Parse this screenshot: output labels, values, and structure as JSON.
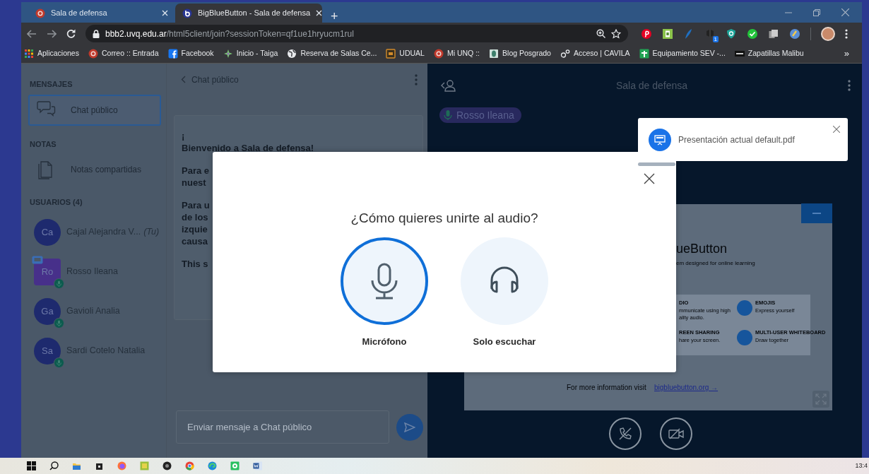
{
  "browser": {
    "tabs": [
      {
        "title": "Sala de defensa",
        "selected": false,
        "kind": "seal"
      },
      {
        "title": "BigBlueButton - Sala de defensa",
        "selected": true,
        "kind": "bbb"
      }
    ],
    "new_tab": "+",
    "address": {
      "host": "bbb2.uvq.edu.ar",
      "path": "/html5client/join?sessionToken=qf1ue1hryucm1rul"
    },
    "extension_badge": "1",
    "bookmarks": [
      {
        "label": "Aplicaciones",
        "kind": "apps"
      },
      {
        "label": "Correo :: Entrada",
        "kind": "seal"
      },
      {
        "label": "Facebook",
        "kind": "facebook"
      },
      {
        "label": "Inicio - Taiga",
        "kind": "taiga"
      },
      {
        "label": "Reserva de Salas Ce...",
        "kind": "globe"
      },
      {
        "label": "UDUAL",
        "kind": "box"
      },
      {
        "label": "Mi UNQ ::",
        "kind": "seal"
      },
      {
        "label": "Blog Posgrado",
        "kind": "doc"
      },
      {
        "label": "Acceso | CAVILA",
        "kind": "gears"
      },
      {
        "label": "Equipamiento SEV -...",
        "kind": "cross"
      },
      {
        "label": "Zapatillas Malibu",
        "kind": "smk"
      }
    ],
    "more_bookmarks": "»"
  },
  "sidebar": {
    "sections": [
      {
        "heading": "MENSAJES",
        "items": [
          {
            "label": "Chat público",
            "kind": "chat",
            "selected": true
          }
        ]
      },
      {
        "heading": "NOTAS",
        "items": [
          {
            "label": "Notas compartidas",
            "kind": "notes",
            "selected": false
          }
        ]
      }
    ],
    "users_heading": "USUARIOS (4)",
    "users": [
      {
        "initials": "Ca",
        "name": "Cajal Alejandra V...",
        "you": "(Tu)",
        "color": "#1e2a6e",
        "moderator": false,
        "presenter": false,
        "audio": false
      },
      {
        "initials": "Ro",
        "name": "Rosso Ileana",
        "color": "#47308a",
        "moderator": true,
        "presenter": true,
        "audio": true
      },
      {
        "initials": "Ga",
        "name": "Gavioli Analia",
        "color": "#1e2a6e",
        "moderator": false,
        "presenter": false,
        "audio": true
      },
      {
        "initials": "Sa",
        "name": "Sardi Cotelo Natalia",
        "color": "#1e2a6e",
        "moderator": false,
        "presenter": false,
        "audio": true
      }
    ]
  },
  "chat": {
    "title": "Chat público",
    "paragraphs": [
      [
        "¡",
        "Bienvenido a **Sala de defensa**!"
      ],
      [
        "Para e",
        "nuest"
      ],
      [
        "Para u",
        "de los",
        "izquie",
        "causa"
      ],
      [
        "This s"
      ]
    ],
    "input_placeholder": "Enviar mensaje a Chat público"
  },
  "presentation": {
    "title": "Sala de defensa",
    "talking": "Rosso Ileana",
    "slide": {
      "heading": "ueButton",
      "subheading": "em designed for online learning",
      "features": [
        {
          "title": "DIO",
          "lines": [
            "mmunicate using high",
            "ality audio."
          ],
          "icon": false
        },
        {
          "title": "EMOJIS",
          "lines": [
            "Express yourself"
          ],
          "icon": true
        },
        {
          "title": "REEN SHARING",
          "lines": [
            "hare your screen."
          ],
          "icon": false
        },
        {
          "title": "MULTI-USER WHITEBOARD",
          "lines": [
            "Draw together"
          ],
          "icon": true
        }
      ],
      "footer": "For more information visit",
      "link": "bigbluebutton.org →"
    }
  },
  "toast": {
    "text": "Presentación actual default.pdf",
    "level": 0.18
  },
  "modal": {
    "title": "¿Cómo quieres unirte al audio?",
    "options": [
      {
        "label": "Micrófono",
        "kind": "mic",
        "selected": true
      },
      {
        "label": "Solo escuchar",
        "kind": "listen",
        "selected": false
      }
    ]
  },
  "taskbar": {
    "clock": "13:4"
  }
}
